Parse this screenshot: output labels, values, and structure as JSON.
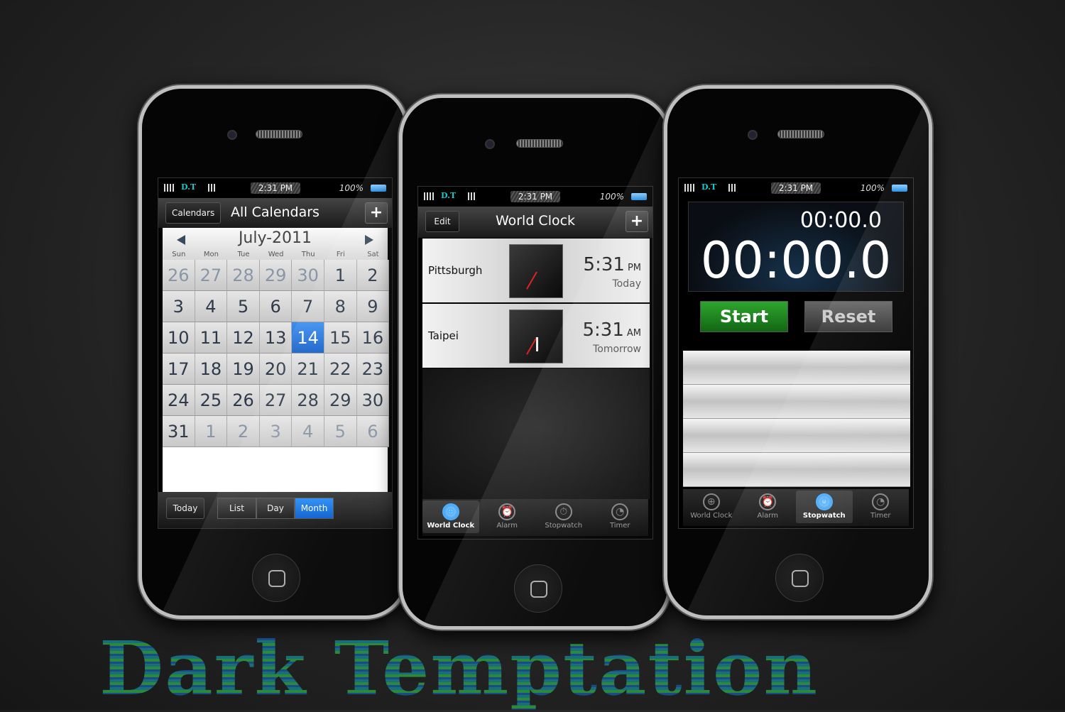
{
  "status": {
    "carrier": "D.T",
    "time": "2:31 PM",
    "battery": "100%"
  },
  "calendar": {
    "back_label": "Calendars",
    "title": "All Calendars",
    "add_label": "+",
    "month": "July-2011",
    "weekdays": [
      "Sun",
      "Mon",
      "Tue",
      "Wed",
      "Thu",
      "Fri",
      "Sat"
    ],
    "days": [
      [
        26,
        0
      ],
      [
        27,
        0
      ],
      [
        28,
        0
      ],
      [
        29,
        0
      ],
      [
        30,
        0
      ],
      [
        1,
        1
      ],
      [
        2,
        1
      ],
      [
        3,
        1
      ],
      [
        4,
        1
      ],
      [
        5,
        1
      ],
      [
        6,
        1
      ],
      [
        7,
        1
      ],
      [
        8,
        1
      ],
      [
        9,
        1
      ],
      [
        10,
        1
      ],
      [
        11,
        1
      ],
      [
        12,
        1
      ],
      [
        13,
        1
      ],
      [
        14,
        1
      ],
      [
        15,
        1
      ],
      [
        16,
        1
      ],
      [
        17,
        1
      ],
      [
        18,
        1
      ],
      [
        19,
        1
      ],
      [
        20,
        1
      ],
      [
        21,
        1
      ],
      [
        22,
        1
      ],
      [
        23,
        1
      ],
      [
        24,
        1
      ],
      [
        25,
        1
      ],
      [
        26,
        1
      ],
      [
        27,
        1
      ],
      [
        28,
        1
      ],
      [
        29,
        1
      ],
      [
        30,
        1
      ],
      [
        31,
        1
      ],
      [
        1,
        0
      ],
      [
        2,
        0
      ],
      [
        3,
        0
      ],
      [
        4,
        0
      ],
      [
        5,
        0
      ],
      [
        6,
        0
      ]
    ],
    "selected_day": 14,
    "toolbar": {
      "today": "Today",
      "list": "List",
      "day": "Day",
      "month": "Month",
      "active": "Month"
    }
  },
  "world_clock": {
    "edit_label": "Edit",
    "title": "World Clock",
    "add_label": "+",
    "cities": [
      {
        "city": "Pittsburgh",
        "time": "5:31",
        "ampm": "PM",
        "day": "Today"
      },
      {
        "city": "Taipei",
        "time": "5:31",
        "ampm": "AM",
        "day": "Tomorrow"
      }
    ]
  },
  "stopwatch": {
    "lap_time": "00:00.0",
    "total_time": "00:00.0",
    "start_label": "Start",
    "reset_label": "Reset"
  },
  "tabs": [
    {
      "label": "World Clock",
      "icon": "globe-icon"
    },
    {
      "label": "Alarm",
      "icon": "alarm-icon"
    },
    {
      "label": "Stopwatch",
      "icon": "stopwatch-icon"
    },
    {
      "label": "Timer",
      "icon": "timer-icon"
    }
  ],
  "colors": {
    "accent": "#1a73e0",
    "start_green": "#1e8a1e"
  },
  "brand": "Dark Temptation"
}
